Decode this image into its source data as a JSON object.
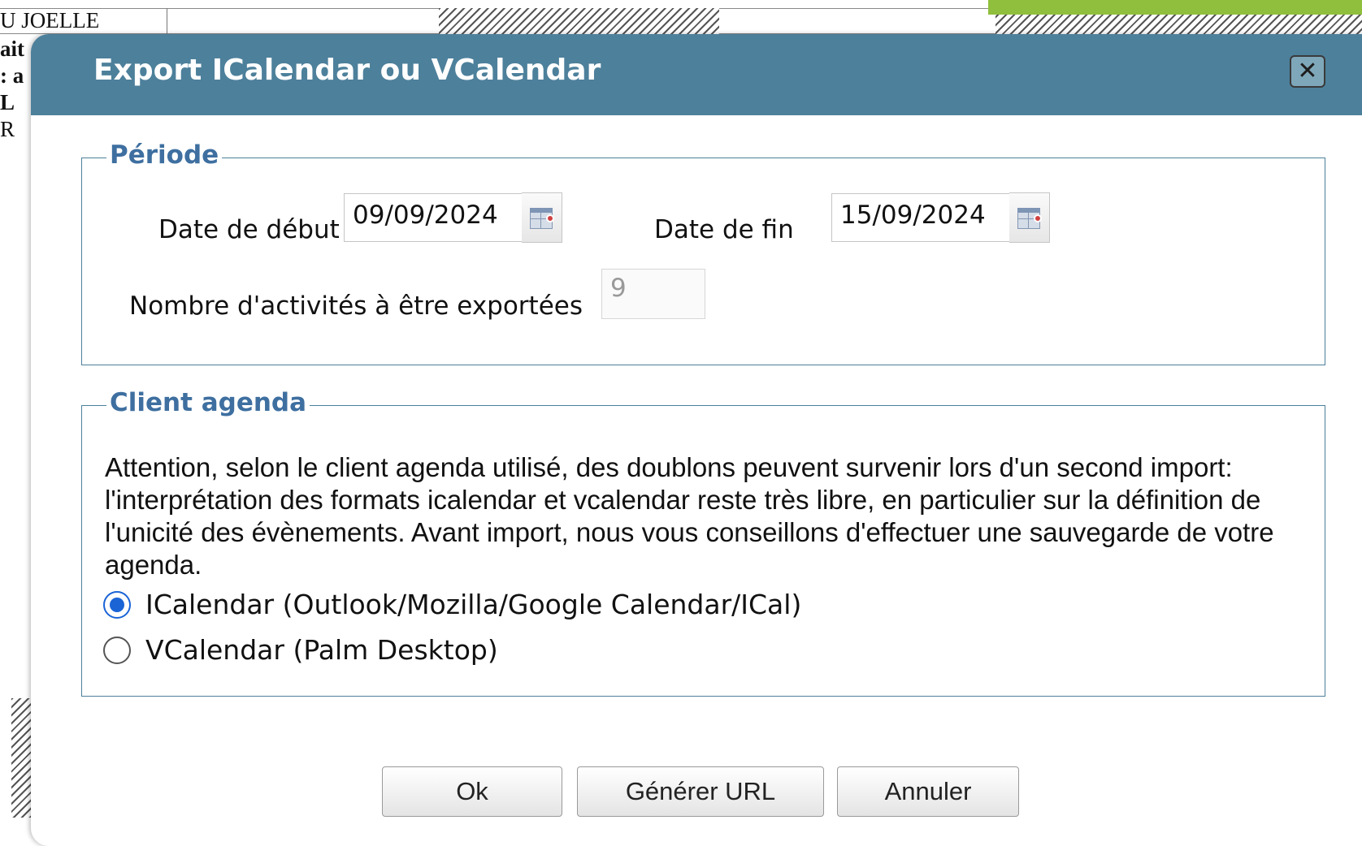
{
  "background": {
    "name_text": "U JOELLE",
    "side_lines": [
      "ait",
      ": a",
      "L",
      "R"
    ]
  },
  "dialog": {
    "title": "Export ICalendar ou VCalendar",
    "close_glyph": "✕",
    "periode": {
      "legend": "Période",
      "start_label": "Date de début",
      "start_value": "09/09/2024",
      "end_label": "Date de fin",
      "end_value": "15/09/2024",
      "count_label": "Nombre d'activités à être exportées",
      "count_value": "9"
    },
    "client": {
      "legend": "Client agenda",
      "notice": "Attention, selon le client agenda utilisé, des doublons peuvent survenir lors d'un second import: l'interprétation des formats icalendar et vcalendar reste très libre, en particulier sur la définition de l'unicité des évènements. Avant import, nous vous conseillons d'effectuer une sauvegarde de votre agenda.",
      "options": [
        {
          "label": "ICalendar (Outlook/Mozilla/Google Calendar/ICal)",
          "checked": true
        },
        {
          "label": "VCalendar (Palm Desktop)",
          "checked": false
        }
      ]
    },
    "buttons": {
      "ok": "Ok",
      "generate_url": "Générer URL",
      "cancel": "Annuler"
    }
  },
  "colors": {
    "titlebar": "#4d809b",
    "legend": "#3e6fa0",
    "radio_accent": "#1a64d6"
  },
  "icons": [
    "close-icon",
    "calendar-icon"
  ]
}
